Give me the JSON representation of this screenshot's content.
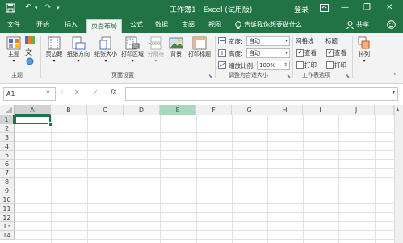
{
  "window": {
    "title": "工作簿1 - Excel (试用版)",
    "login": "登录",
    "minimize": "—",
    "restore": "❐",
    "close": "✕",
    "qat_undo": "↶",
    "qat_redo": "↷",
    "qat_more": "▾"
  },
  "tabs": [
    "文件",
    "开始",
    "插入",
    "页面布局",
    "公式",
    "数据",
    "审阅",
    "视图"
  ],
  "active_tab": "页面布局",
  "tell_me": "告诉我你想要做什么",
  "share": "共享",
  "ribbon": {
    "themes": {
      "theme_label": "主题",
      "group_label": "主题"
    },
    "page_setup": {
      "buttons": [
        "页边距",
        "纸张方向",
        "纸张大小",
        "打印区域",
        "分隔符",
        "背景",
        "打印标题"
      ],
      "group_label": "页面设置"
    },
    "scale_to_fit": {
      "width_label": "宽度:",
      "width_value": "自动",
      "height_label": "高度:",
      "height_value": "自动",
      "scale_label": "缩放比例:",
      "scale_value": "100%",
      "group_label": "调整为合适大小"
    },
    "sheet_options": {
      "gridlines_header": "网格线",
      "headings_header": "标题",
      "view_label": "查看",
      "print_label": "打印",
      "gridlines_view_checked": true,
      "gridlines_print_checked": false,
      "headings_view_checked": true,
      "headings_print_checked": false,
      "group_label": "工作表选项"
    },
    "arrange": {
      "label": "排列"
    }
  },
  "formula_bar": {
    "name_box": "A1",
    "cancel": "✕",
    "enter": "✓",
    "fx": "fx",
    "formula": ""
  },
  "sheet": {
    "columns": [
      "A",
      "B",
      "C",
      "D",
      "E",
      "F",
      "G",
      "H",
      "I",
      "J"
    ],
    "rows": [
      "1",
      "2",
      "3",
      "4",
      "5",
      "6",
      "7",
      "8",
      "9",
      "10",
      "11",
      "12",
      "13",
      "14"
    ],
    "selected_cell": "A1",
    "highlighted_column": "E"
  },
  "colors": {
    "excel_green": "#217346",
    "ribbon_bg": "#f3f3f3"
  }
}
